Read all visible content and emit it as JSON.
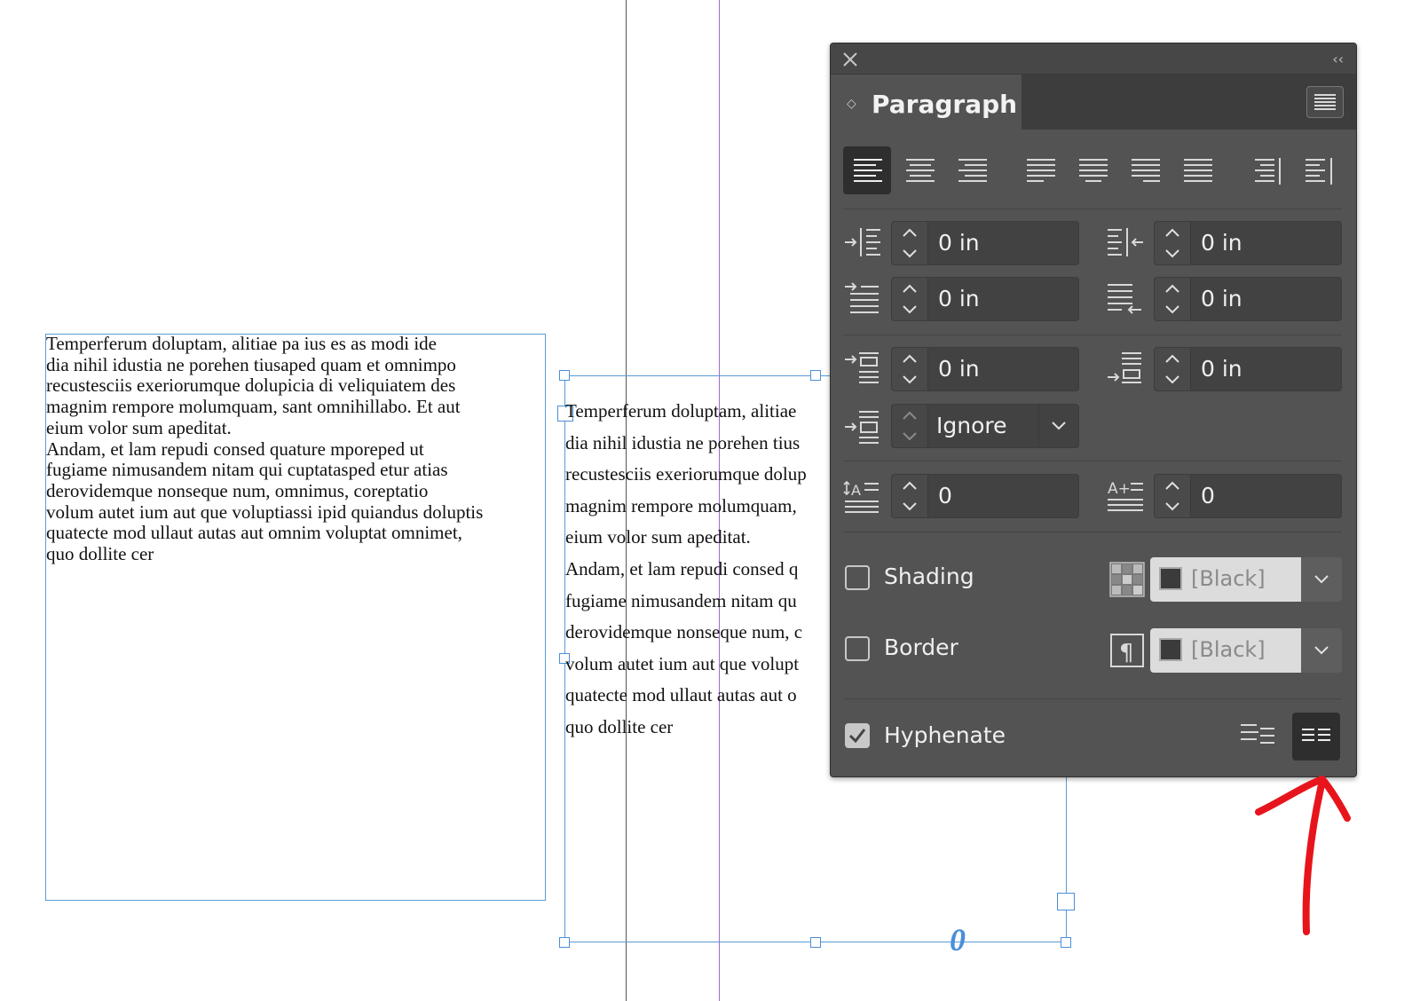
{
  "document": {
    "frame1_text": "Temperferum doluptam, alitiae pa ius es as modi ide\ndia nihil idustia ne porehen tiusaped quam et omnimpo\nrecustesciis exeriorumque dolupicia di veliquiatem des\nmagnim rempore molumquam, sant omnihillabo. Et aut\neium volor sum apeditat.\nAndam, et lam repudi consed quature mporeped ut\nfugiame nimusandem nitam qui cuptatasped etur atias\nderovidemque nonseque num, omnimus, coreptatio\nvolum autet ium aut que voluptiassi ipid quiandus doluptis\nquatecte mod ullaut autas aut omnim voluptat omnimet,\nquo dollite cer",
    "frame2_text": "Temperferum doluptam, alitiae\ndia nihil idustia ne porehen tius\nrecustesciis exeriorumque dolup\nmagnim rempore molumquam,\neium volor sum apeditat.\nAndam, et lam repudi consed q\nfugiame nimusandem nitam qu\nderovidemque nonseque num, c\nvolum autet ium aut que volupt\nquatecte mod ullaut autas aut o\nquo dollite cer",
    "overset_marker": "0"
  },
  "panel": {
    "tab_label": "Paragraph",
    "collapse_glyph": "‹‹",
    "tab_updown_glyph": "◇",
    "alignment_buttons": [
      {
        "name": "align-left",
        "active": true
      },
      {
        "name": "align-center",
        "active": false
      },
      {
        "name": "align-right",
        "active": false
      },
      {
        "name": "justify-left",
        "active": false
      },
      {
        "name": "justify-center",
        "active": false
      },
      {
        "name": "justify-right",
        "active": false
      },
      {
        "name": "justify-all",
        "active": false
      },
      {
        "name": "align-towards-spine",
        "active": false
      },
      {
        "name": "align-away-from-spine",
        "active": false
      }
    ],
    "left_indent": "0 in",
    "right_indent": "0 in",
    "first_line_indent": "0 in",
    "last_line_right_indent": "0 in",
    "space_before": "0 in",
    "space_after": "0 in",
    "space_between": "Ignore",
    "drop_cap_lines": "0",
    "drop_cap_chars": "0",
    "shading": {
      "label": "Shading",
      "checked": false,
      "swatch": "[Black]"
    },
    "border": {
      "label": "Border",
      "checked": false,
      "swatch": "[Black]"
    },
    "hyphenate": {
      "label": "Hyphenate",
      "checked": true
    }
  },
  "colors": {
    "panel_bg": "#535353",
    "frame_blue": "#5b9bd5",
    "guide_purple": "#9b6bd6",
    "annotation_red": "#e8141c"
  }
}
